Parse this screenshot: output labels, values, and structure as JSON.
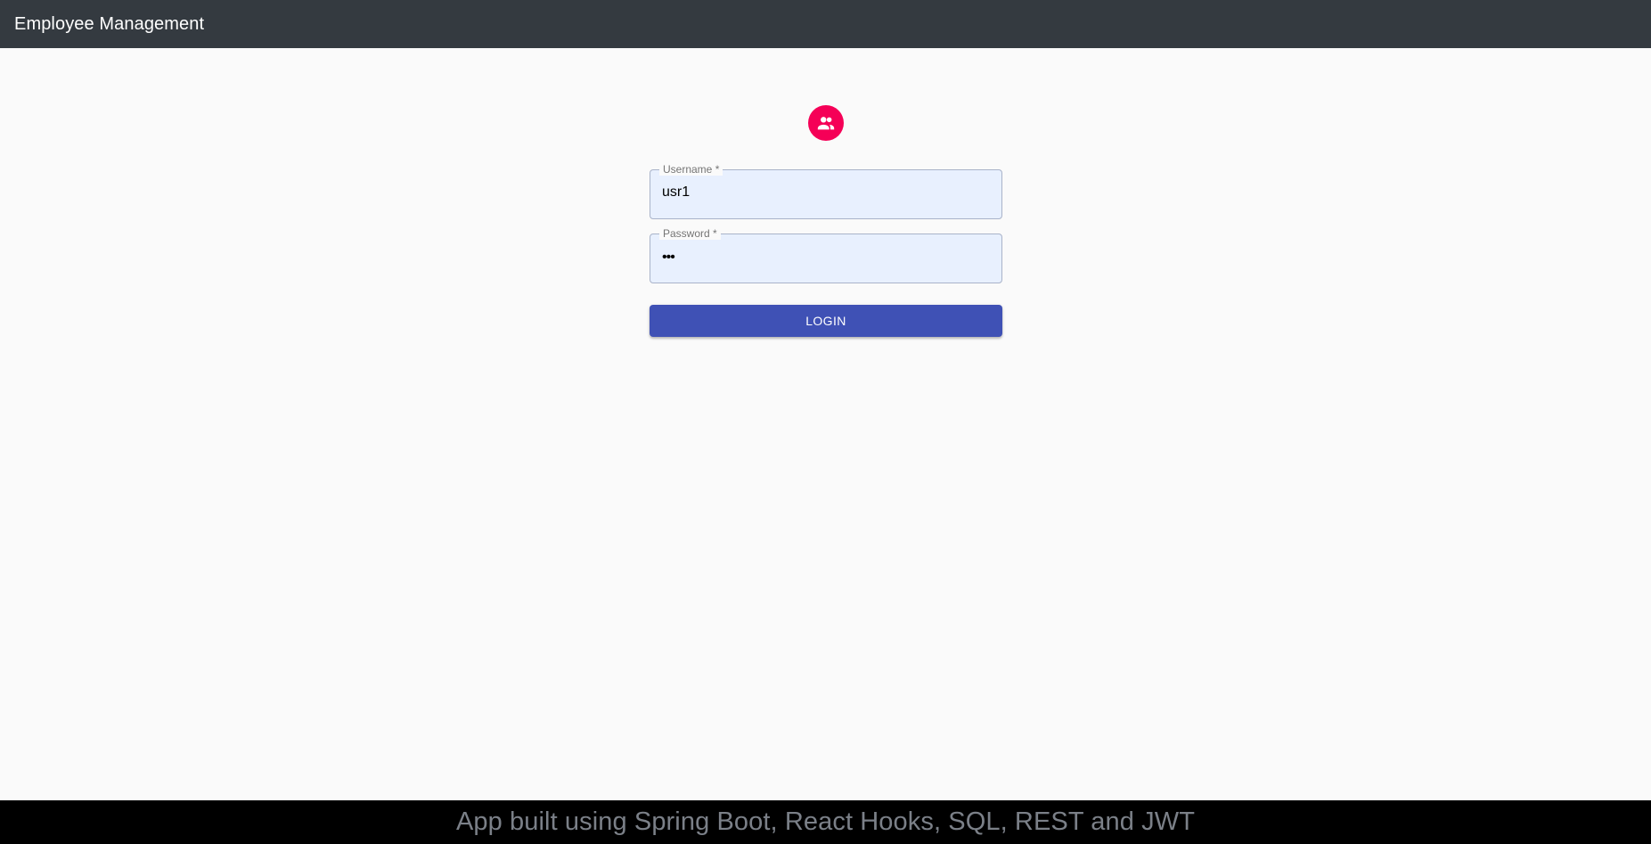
{
  "appbar": {
    "title": "Employee Management"
  },
  "avatar": {
    "icon": "people-icon",
    "color": "#f50057"
  },
  "form": {
    "username": {
      "label": "Username *",
      "value": "usr1"
    },
    "password": {
      "label": "Password *",
      "masked_value": "•••"
    },
    "login_label": "LOGIN"
  },
  "footer": {
    "text": "App built using Spring Boot, React Hooks, SQL, REST and JWT"
  },
  "colors": {
    "appbar": "#343a40",
    "primary": "#3f51b5",
    "secondary": "#f50057",
    "input_fill": "#e8f0fe"
  }
}
